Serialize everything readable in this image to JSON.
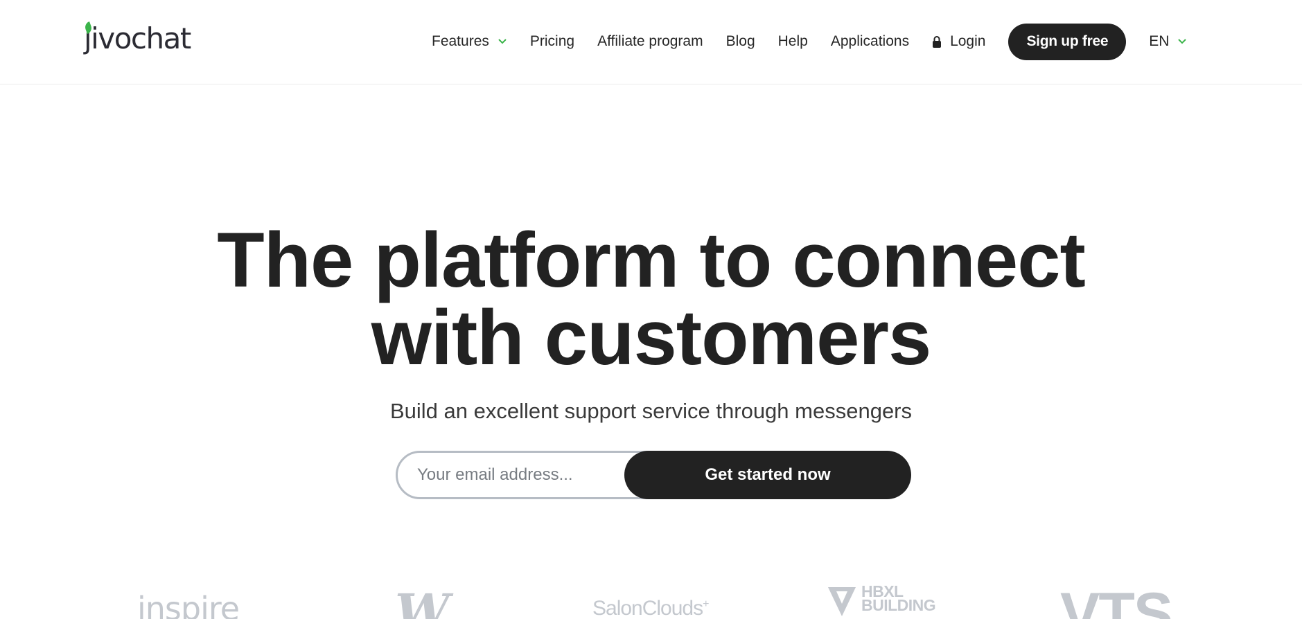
{
  "header": {
    "logo_text": "jivochat",
    "nav": [
      {
        "label": "Features",
        "has_dropdown": true
      },
      {
        "label": "Pricing"
      },
      {
        "label": "Affiliate program"
      },
      {
        "label": "Blog"
      },
      {
        "label": "Help"
      },
      {
        "label": "Applications"
      }
    ],
    "login_label": "Login",
    "signup_label": "Sign up free",
    "language": "EN"
  },
  "hero": {
    "title_line1": "The platform to connect",
    "title_line2": "with customers",
    "subtitle": "Build an excellent support service through messengers",
    "email_placeholder": "Your email address...",
    "cta_label": "Get started now"
  },
  "client_logos": [
    {
      "name": "inspire",
      "icon": "inspire-logo"
    },
    {
      "name": "W",
      "icon": "w-logo"
    },
    {
      "name": "SalonClouds",
      "suffix": "+",
      "icon": "salonclouds-logo"
    },
    {
      "name_line1": "HBXL",
      "name_line2": "BUILDING",
      "icon": "hbxl-logo"
    },
    {
      "name": "VTS",
      "icon": "vts-logo"
    }
  ],
  "colors": {
    "accent_green": "#3bb44a",
    "dark_button": "#222222",
    "text": "#222222",
    "logo_gray": "#c4c8ce"
  }
}
